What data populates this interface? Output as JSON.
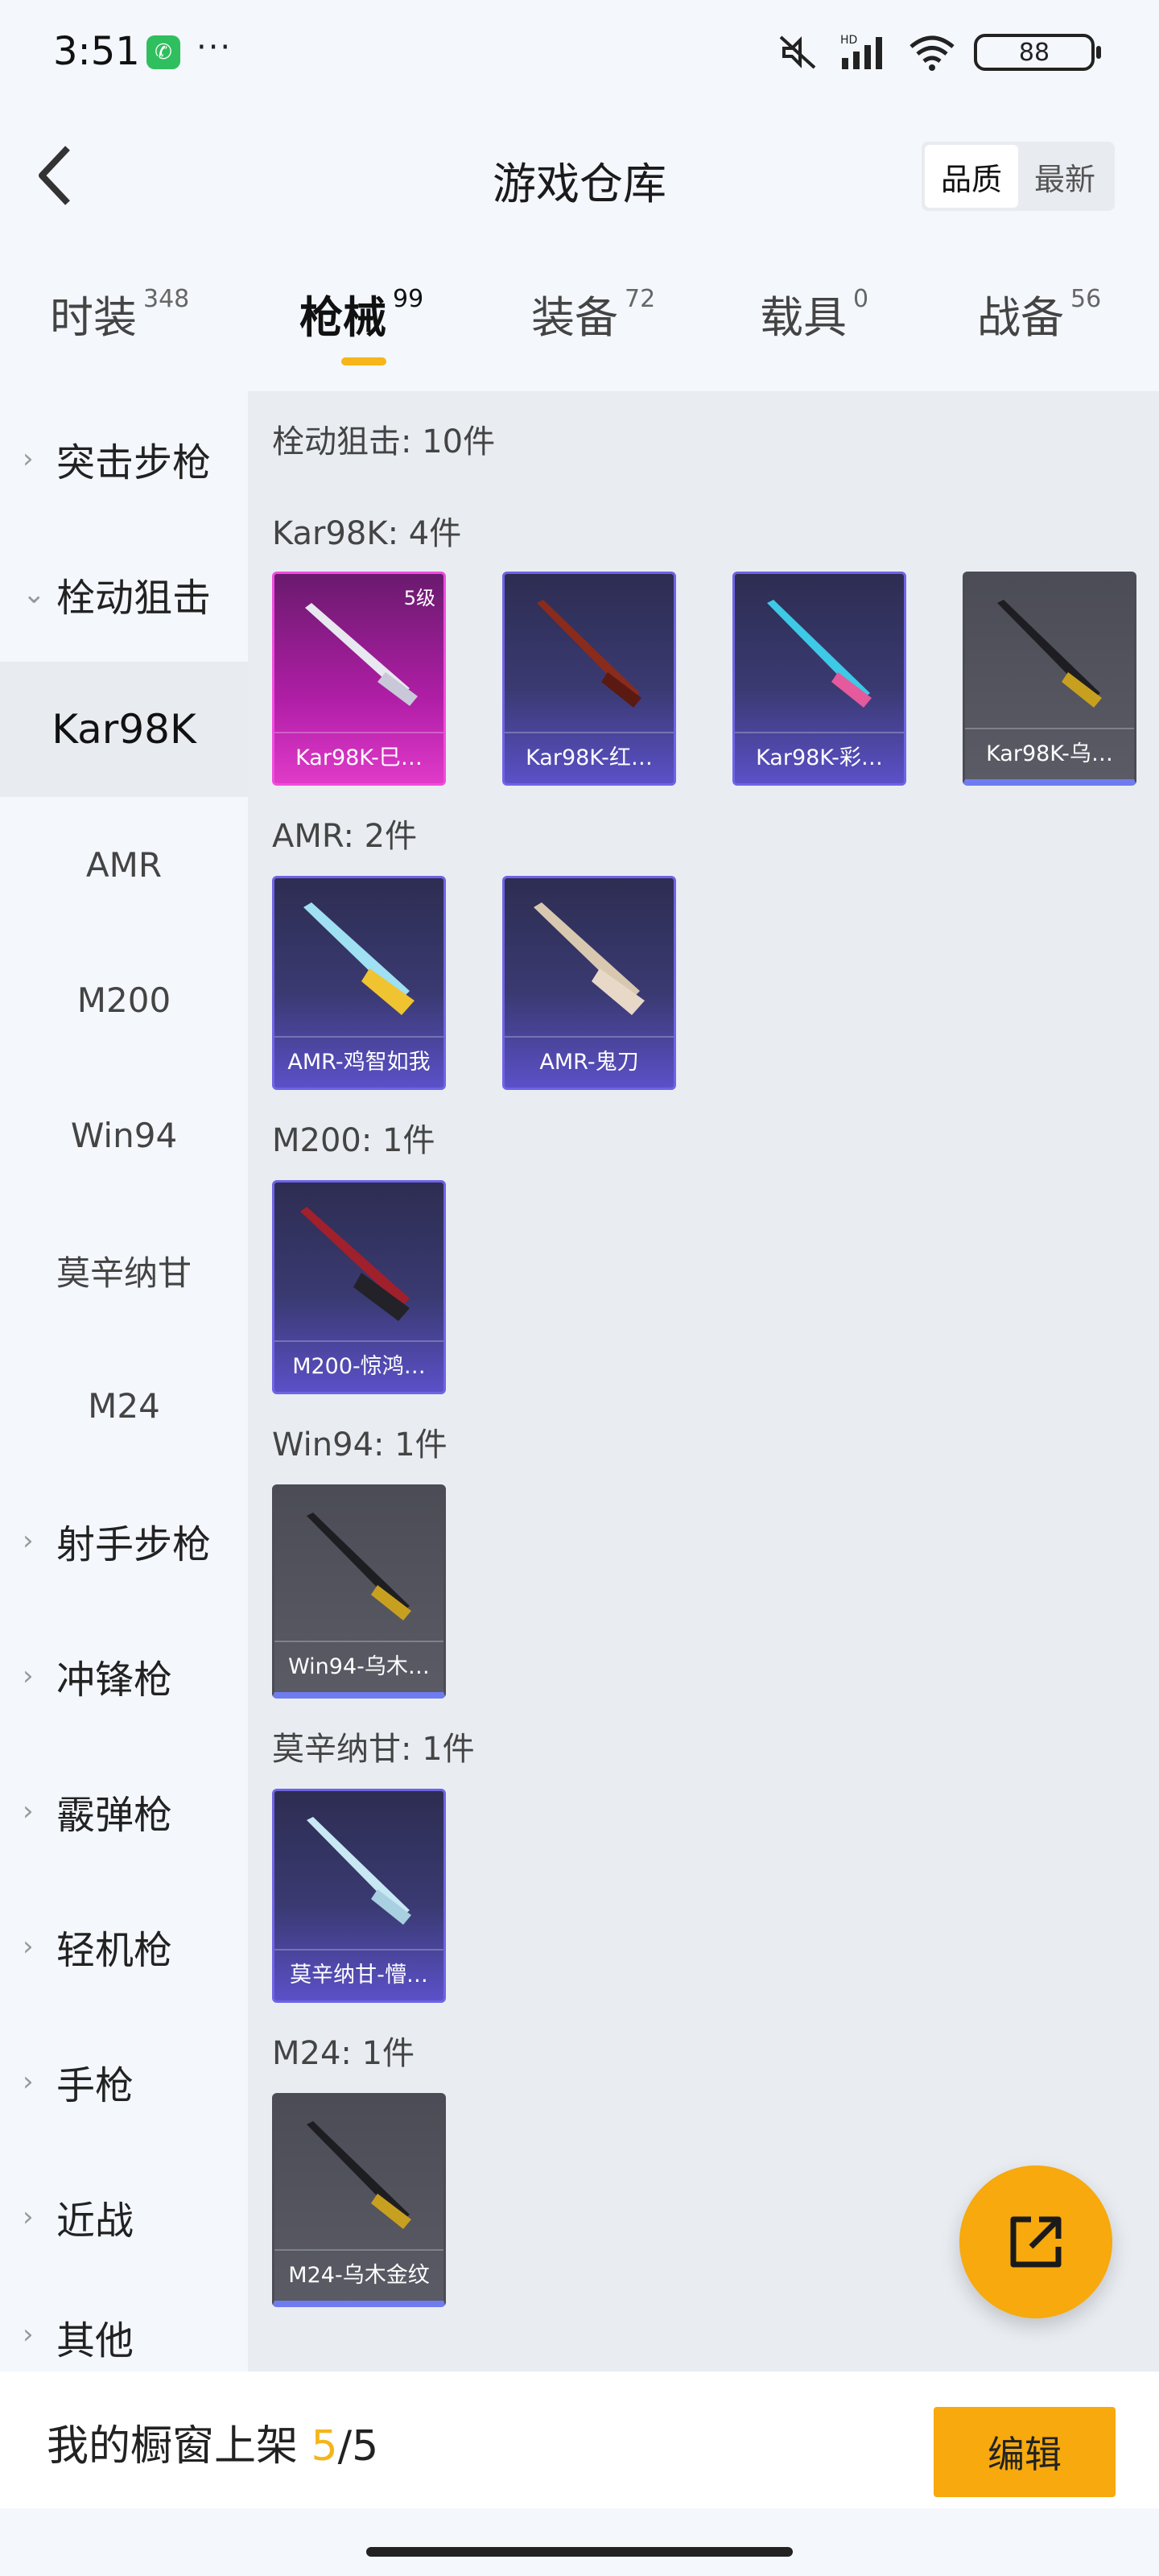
{
  "status": {
    "time": "3:51",
    "more": "···",
    "battery": "88",
    "network": "HD"
  },
  "header": {
    "title": "游戏仓库",
    "sort": [
      "品质",
      "最新"
    ]
  },
  "categories": [
    {
      "label": "时装",
      "count": "348"
    },
    {
      "label": "枪械",
      "count": "99"
    },
    {
      "label": "装备",
      "count": "72"
    },
    {
      "label": "载具",
      "count": "0"
    },
    {
      "label": "战备",
      "count": "56"
    }
  ],
  "sidebar": {
    "groups": [
      "突击步枪",
      "栓动狙击",
      "射手步枪",
      "冲锋枪",
      "霰弹枪",
      "轻机枪",
      "手枪",
      "近战",
      "其他"
    ],
    "subs": [
      "Kar98K",
      "AMR",
      "M200",
      "Win94",
      "莫辛纳甘",
      "M24"
    ]
  },
  "content": {
    "header": "栓动狙击: 10件",
    "sections": [
      {
        "title": "Kar98K: 4件",
        "items": [
          {
            "name": "Kar98K-巳…",
            "level": "5级",
            "rarity": "pink"
          },
          {
            "name": "Kar98K-红…",
            "rarity": "purple"
          },
          {
            "name": "Kar98K-彩…",
            "rarity": "purple"
          },
          {
            "name": "Kar98K-乌…",
            "rarity": "gray"
          }
        ]
      },
      {
        "title": "AMR: 2件",
        "items": [
          {
            "name": "AMR-鸡智如我",
            "rarity": "purple"
          },
          {
            "name": "AMR-鬼刀",
            "rarity": "purple"
          }
        ]
      },
      {
        "title": "M200: 1件",
        "items": [
          {
            "name": "M200-惊鸿…",
            "rarity": "purple"
          }
        ]
      },
      {
        "title": "Win94: 1件",
        "items": [
          {
            "name": "Win94-乌木…",
            "rarity": "gray"
          }
        ]
      },
      {
        "title": "莫辛纳甘: 1件",
        "items": [
          {
            "name": "莫辛纳甘-懵…",
            "rarity": "purple"
          }
        ]
      },
      {
        "title": "M24: 1件",
        "items": [
          {
            "name": "M24-乌木金纹",
            "rarity": "gray"
          }
        ]
      }
    ]
  },
  "bottom": {
    "shelf_label": "我的橱窗上架",
    "shelf_current": "5",
    "shelf_sep": "/",
    "shelf_total": "5",
    "edit_label": "编辑"
  },
  "colors": {
    "accent": "#f7a90d",
    "pink": "#e03ac9",
    "purple": "#5b50c8",
    "gray": "#5a5b65"
  }
}
